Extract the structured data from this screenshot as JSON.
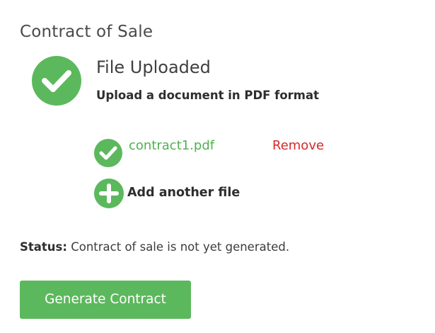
{
  "section": {
    "title": "Contract of Sale"
  },
  "upload": {
    "heading": "File Uploaded",
    "hint": "Upload a document in PDF format",
    "icon": "check-circle-icon"
  },
  "files": [
    {
      "name": "contract1.pdf",
      "remove_label": "Remove",
      "icon": "check-circle-icon"
    }
  ],
  "add_file": {
    "label": "Add another file",
    "icon": "plus-circle-icon"
  },
  "status": {
    "label": "Status:",
    "text": "Contract of sale is not yet generated."
  },
  "actions": {
    "generate_label": "Generate Contract"
  },
  "colors": {
    "accent_green": "#5cb85c",
    "link_green": "#4fb14f",
    "danger_red": "#d42a2a",
    "text": "#3c3c3c"
  }
}
